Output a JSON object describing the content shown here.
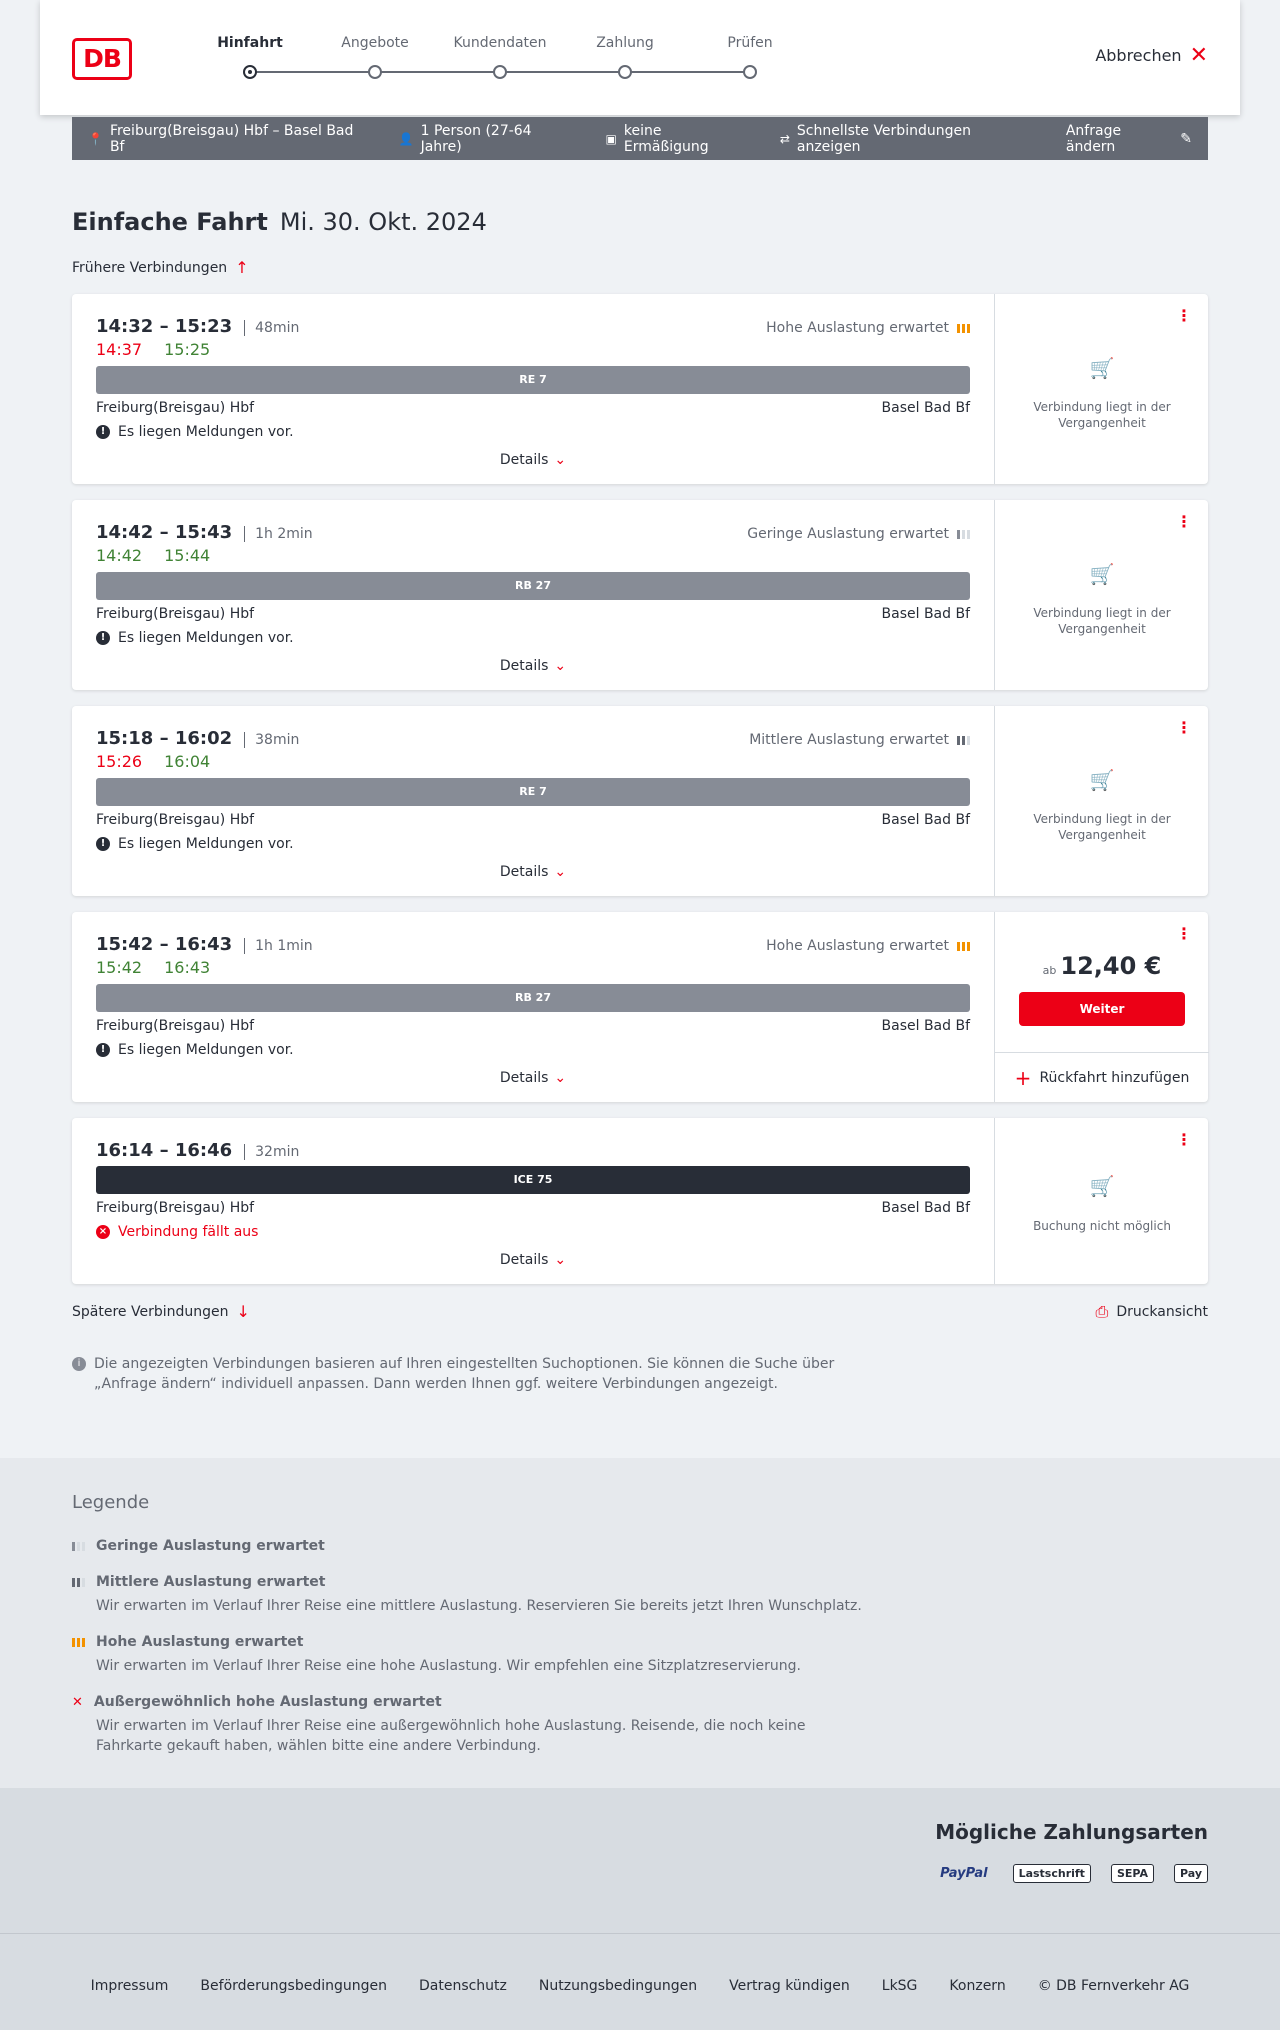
{
  "header": {
    "logo": "DB",
    "steps": [
      "Hinfahrt",
      "Angebote",
      "Kundendaten",
      "Zahlung",
      "Prüfen"
    ],
    "cancel": "Abbrechen"
  },
  "summary": {
    "route": "Freiburg(Breisgau) Hbf – Basel Bad Bf",
    "persons": "1 Person (27-64 Jahre)",
    "discount": "keine Ermäßigung",
    "fastest": "Schnellste Verbindungen anzeigen",
    "edit": "Anfrage ändern"
  },
  "title": {
    "kind": "Einfache Fahrt",
    "date": "Mi. 30. Okt. 2024"
  },
  "earlier": "Frühere Verbindungen",
  "later": "Spätere Verbindungen",
  "print": "Druckansicht",
  "details_label": "Details",
  "connections": [
    {
      "times": "14:32 – 15:23",
      "duration": "48min",
      "rt_dep": "14:37",
      "rt_arr": "15:25",
      "occupancy": "Hohe Auslastung erwartet",
      "train": "RE 7",
      "from": "Freiburg(Breisgau) Hbf",
      "to": "Basel Bad Bf",
      "message": "Es liegen Meldungen vor.",
      "status": "Verbindung liegt in der Vergangenheit"
    },
    {
      "times": "14:42 – 15:43",
      "duration": "1h 2min",
      "rt_dep": "14:42",
      "rt_arr": "15:44",
      "occupancy": "Geringe Auslastung erwartet",
      "train": "RB 27",
      "from": "Freiburg(Breisgau) Hbf",
      "to": "Basel Bad Bf",
      "message": "Es liegen Meldungen vor.",
      "status": "Verbindung liegt in der Vergangenheit"
    },
    {
      "times": "15:18 – 16:02",
      "duration": "38min",
      "rt_dep": "15:26",
      "rt_arr": "16:04",
      "occupancy": "Mittlere Auslastung erwartet",
      "train": "RE 7",
      "from": "Freiburg(Breisgau) Hbf",
      "to": "Basel Bad Bf",
      "message": "Es liegen Meldungen vor.",
      "status": "Verbindung liegt in der Vergangenheit"
    },
    {
      "times": "15:42 – 16:43",
      "duration": "1h 1min",
      "rt_dep": "15:42",
      "rt_arr": "16:43",
      "occupancy": "Hohe Auslastung erwartet",
      "train": "RB 27",
      "from": "Freiburg(Breisgau) Hbf",
      "to": "Basel Bad Bf",
      "message": "Es liegen Meldungen vor.",
      "price_prefix": "ab",
      "price": "12,40 €",
      "button": "Weiter",
      "return": "Rückfahrt hinzufügen"
    },
    {
      "times": "16:14 – 16:46",
      "duration": "32min",
      "train": "ICE 75",
      "from": "Freiburg(Breisgau) Hbf",
      "to": "Basel Bad Bf",
      "message": "Verbindung fällt aus",
      "status": "Buchung nicht möglich"
    }
  ],
  "note": "Die angezeigten Verbindungen basieren auf Ihren eingestellten Suchoptionen. Sie können die Suche über „Anfrage ändern“ individuell anpassen. Dann werden Ihnen ggf. weitere Verbindungen angezeigt.",
  "legend": {
    "title": "Legende",
    "items": [
      {
        "title": "Geringe Auslastung erwartet",
        "desc": ""
      },
      {
        "title": "Mittlere Auslastung erwartet",
        "desc": "Wir erwarten im Verlauf Ihrer Reise eine mittlere Auslastung. Reservieren Sie bereits jetzt Ihren Wunschplatz."
      },
      {
        "title": "Hohe Auslastung erwartet",
        "desc": "Wir erwarten im Verlauf Ihrer Reise eine hohe Auslastung. Wir empfehlen eine Sitzplatzreservierung."
      },
      {
        "title": "Außergewöhnlich hohe Auslastung erwartet",
        "desc": "Wir erwarten im Verlauf Ihrer Reise eine außergewöhnlich hohe Auslastung. Reisende, die noch keine Fahrkarte gekauft haben, wählen bitte eine andere Verbindung."
      }
    ]
  },
  "payment": {
    "title": "Mögliche Zahlungsarten",
    "methods": [
      "PayPal",
      "Lastschrift",
      "SEPA",
      "Pay"
    ]
  },
  "footer": [
    "Impressum",
    "Beförderungsbedingungen",
    "Datenschutz",
    "Nutzungsbedingungen",
    "Vertrag kündigen",
    "LkSG",
    "Konzern",
    "© DB Fernverkehr AG"
  ],
  "colors": {
    "accent": "#ec0016",
    "late": "#ec0016",
    "ontime": "#408335",
    "high_occupancy": "#f39200",
    "summary_bg": "#646973"
  }
}
